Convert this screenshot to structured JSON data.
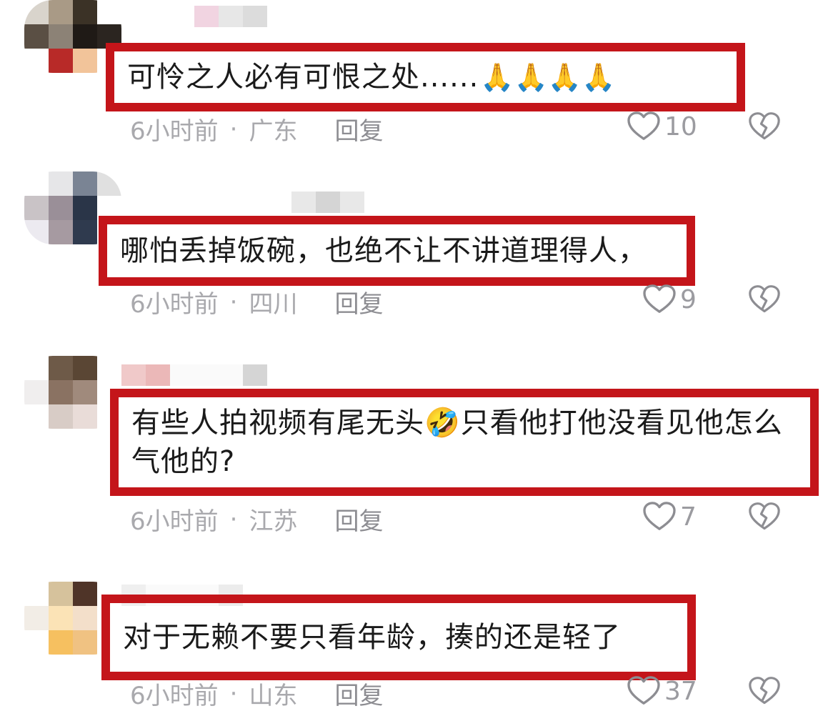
{
  "comments": [
    {
      "text": "可怜之人必有可恨之处......",
      "emoji": "🙏🙏🙏🙏",
      "time": "6小时前",
      "location": "广东",
      "reply": "回复",
      "likes": "10"
    },
    {
      "text": "哪怕丢掉饭碗，也绝不让不讲道理得人，",
      "emoji": "",
      "time": "6小时前",
      "location": "四川",
      "reply": "回复",
      "likes": "9"
    },
    {
      "text": "有些人拍视频有尾无头🤣只看他打他没看见他怎么气他的?",
      "emoji": "",
      "time": "6小时前",
      "location": "江苏",
      "reply": "回复",
      "likes": "7"
    },
    {
      "text": "对于无赖不要只看年龄，揍的还是轻了",
      "emoji": "",
      "time": "6小时前",
      "location": "山东",
      "reply": "回复",
      "likes": "37"
    }
  ],
  "separator": "·",
  "colors": {
    "highlight_border": "#c4151a",
    "meta_text": "#a9a9ad"
  },
  "icons": {
    "like": "heart-outline-icon",
    "dislike": "broken-heart-icon"
  }
}
